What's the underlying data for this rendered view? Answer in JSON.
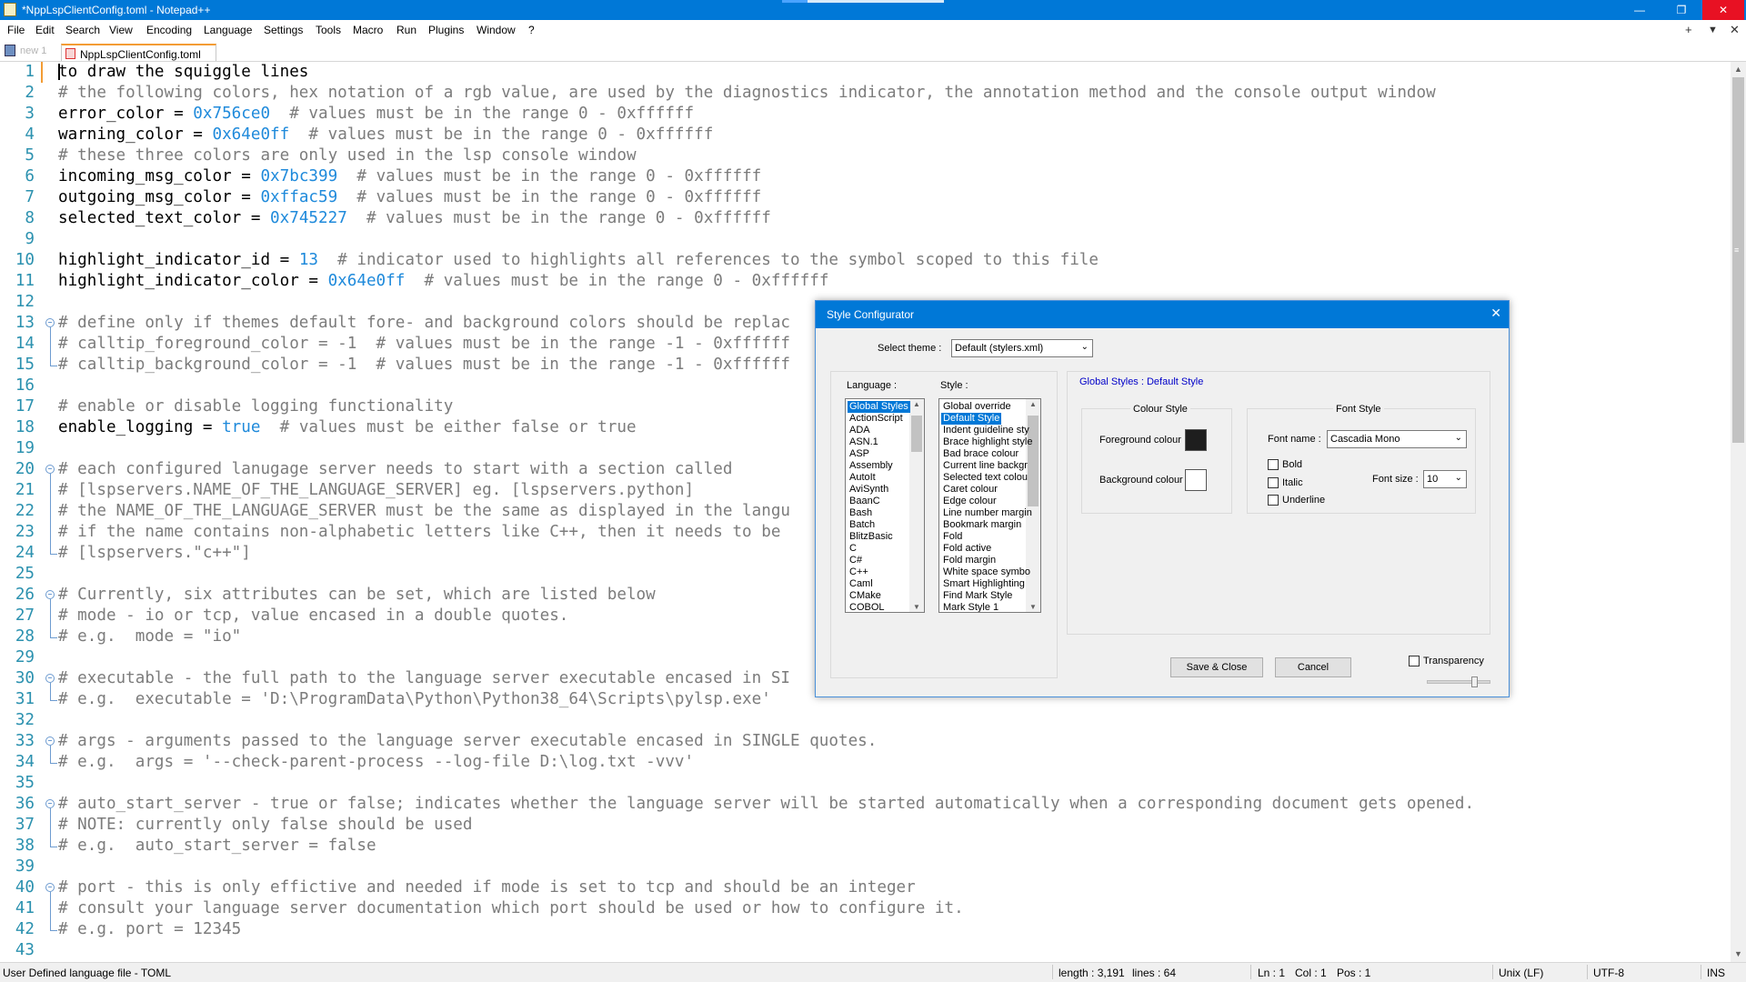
{
  "window": {
    "title": "*NppLspClientConfig.toml - Notepad++",
    "min": "—",
    "restore": "❐",
    "close": "✕"
  },
  "menu": [
    "File",
    "Edit",
    "Search",
    "View",
    "Encoding",
    "Language",
    "Settings",
    "Tools",
    "Macro",
    "Run",
    "Plugins",
    "Window",
    "?"
  ],
  "menu_right": {
    "add": "+",
    "dropdown": "▼",
    "close": "✕"
  },
  "tabs": {
    "ghost": "new 1",
    "active": "NppLspClientConfig.toml"
  },
  "lines": [
    {
      "n": "1",
      "segs": [
        {
          "t": "to draw the squiggle lines",
          "c": ""
        }
      ]
    },
    {
      "n": "2",
      "segs": [
        {
          "t": "# the following colors, hex notation of a rgb value, are used by the diagnostics indicator, the annotation method and the console output window",
          "c": "c-comment"
        }
      ]
    },
    {
      "n": "3",
      "segs": [
        {
          "t": "error_color = ",
          "c": ""
        },
        {
          "t": "0x756ce0",
          "c": "c-num"
        },
        {
          "t": "  # values must be in the range 0 - 0xffffff",
          "c": "c-comment"
        }
      ]
    },
    {
      "n": "4",
      "segs": [
        {
          "t": "warning_color = ",
          "c": ""
        },
        {
          "t": "0x64e0ff",
          "c": "c-num"
        },
        {
          "t": "  # values must be in the range 0 - 0xffffff",
          "c": "c-comment"
        }
      ]
    },
    {
      "n": "5",
      "segs": [
        {
          "t": "# these three colors are only used in the lsp console window",
          "c": "c-comment"
        }
      ]
    },
    {
      "n": "6",
      "segs": [
        {
          "t": "incoming_msg_color = ",
          "c": ""
        },
        {
          "t": "0x7bc399",
          "c": "c-num"
        },
        {
          "t": "  # values must be in the range 0 - 0xffffff",
          "c": "c-comment"
        }
      ]
    },
    {
      "n": "7",
      "segs": [
        {
          "t": "outgoing_msg_color = ",
          "c": ""
        },
        {
          "t": "0xffac59",
          "c": "c-num"
        },
        {
          "t": "  # values must be in the range 0 - 0xffffff",
          "c": "c-comment"
        }
      ]
    },
    {
      "n": "8",
      "segs": [
        {
          "t": "selected_text_color = ",
          "c": ""
        },
        {
          "t": "0x745227",
          "c": "c-num"
        },
        {
          "t": "  # values must be in the range 0 - 0xffffff",
          "c": "c-comment"
        }
      ]
    },
    {
      "n": "9",
      "segs": []
    },
    {
      "n": "10",
      "segs": [
        {
          "t": "highlight_indicator_id = ",
          "c": ""
        },
        {
          "t": "13",
          "c": "c-num"
        },
        {
          "t": "  # indicator used to highlights all references to the symbol scoped to this file",
          "c": "c-comment"
        }
      ]
    },
    {
      "n": "11",
      "segs": [
        {
          "t": "highlight_indicator_color = ",
          "c": ""
        },
        {
          "t": "0x64e0ff",
          "c": "c-num"
        },
        {
          "t": "  # values must be in the range 0 - 0xffffff",
          "c": "c-comment"
        }
      ]
    },
    {
      "n": "12",
      "segs": []
    },
    {
      "n": "13",
      "segs": [
        {
          "t": "# define only if themes default fore- and background colors should be replac",
          "c": "c-comment"
        }
      ]
    },
    {
      "n": "14",
      "segs": [
        {
          "t": "# calltip_foreground_color = -1  # values must be in the range -1 - 0xffffff",
          "c": "c-comment"
        }
      ]
    },
    {
      "n": "15",
      "segs": [
        {
          "t": "# calltip_background_color = -1  # values must be in the range -1 - 0xffffff",
          "c": "c-comment"
        }
      ]
    },
    {
      "n": "16",
      "segs": []
    },
    {
      "n": "17",
      "segs": [
        {
          "t": "# enable or disable logging functionality",
          "c": "c-comment"
        }
      ]
    },
    {
      "n": "18",
      "segs": [
        {
          "t": "enable_logging = ",
          "c": ""
        },
        {
          "t": "true",
          "c": "c-kw"
        },
        {
          "t": "  # values must be either false or true",
          "c": "c-comment"
        }
      ]
    },
    {
      "n": "19",
      "segs": []
    },
    {
      "n": "20",
      "segs": [
        {
          "t": "# each configured lanugage server needs to start with a section called",
          "c": "c-comment"
        }
      ]
    },
    {
      "n": "21",
      "segs": [
        {
          "t": "# [lspservers.NAME_OF_THE_LANGUAGE_SERVER] eg. [lspservers.python]",
          "c": "c-comment"
        }
      ]
    },
    {
      "n": "22",
      "segs": [
        {
          "t": "# the NAME_OF_THE_LANGUAGE_SERVER must be the same as displayed in the langu",
          "c": "c-comment"
        }
      ]
    },
    {
      "n": "23",
      "segs": [
        {
          "t": "# if the name contains non-alphabetic letters like C++, then it needs to be",
          "c": "c-comment"
        }
      ]
    },
    {
      "n": "24",
      "segs": [
        {
          "t": "# [lspservers.\"c++\"]",
          "c": "c-comment"
        }
      ]
    },
    {
      "n": "25",
      "segs": []
    },
    {
      "n": "26",
      "segs": [
        {
          "t": "# Currently, six attributes can be set, which are listed below",
          "c": "c-comment"
        }
      ]
    },
    {
      "n": "27",
      "segs": [
        {
          "t": "# mode - io or tcp, value encased in a double quotes.",
          "c": "c-comment"
        }
      ]
    },
    {
      "n": "28",
      "segs": [
        {
          "t": "# e.g.  mode = \"io\"",
          "c": "c-comment"
        }
      ]
    },
    {
      "n": "29",
      "segs": []
    },
    {
      "n": "30",
      "segs": [
        {
          "t": "# executable - the full path to the language server executable encased in SI",
          "c": "c-comment"
        }
      ]
    },
    {
      "n": "31",
      "segs": [
        {
          "t": "# e.g.  executable = 'D:\\ProgramData\\Python\\Python38_64\\Scripts\\pylsp.exe'",
          "c": "c-comment"
        }
      ]
    },
    {
      "n": "32",
      "segs": []
    },
    {
      "n": "33",
      "segs": [
        {
          "t": "# args - arguments passed to the language server executable encased in SINGLE quotes.",
          "c": "c-comment"
        }
      ]
    },
    {
      "n": "34",
      "segs": [
        {
          "t": "# e.g.  args = '--check-parent-process --log-file D:\\log.txt -vvv'",
          "c": "c-comment"
        }
      ]
    },
    {
      "n": "35",
      "segs": []
    },
    {
      "n": "36",
      "segs": [
        {
          "t": "# auto_start_server - true or false; indicates whether the language server will be started automatically when a corresponding document gets opened.",
          "c": "c-comment"
        }
      ]
    },
    {
      "n": "37",
      "segs": [
        {
          "t": "# NOTE: currently only false should be used",
          "c": "c-comment"
        }
      ]
    },
    {
      "n": "38",
      "segs": [
        {
          "t": "# e.g.  auto_start_server = false",
          "c": "c-comment"
        }
      ]
    },
    {
      "n": "39",
      "segs": []
    },
    {
      "n": "40",
      "segs": [
        {
          "t": "# port - this is only effictive and needed if mode is set to tcp and should be an integer",
          "c": "c-comment"
        }
      ]
    },
    {
      "n": "41",
      "segs": [
        {
          "t": "# consult your language server documentation which port should be used or how to configure it.",
          "c": "c-comment"
        }
      ]
    },
    {
      "n": "42",
      "segs": [
        {
          "t": "# e.g. port = 12345",
          "c": "c-comment"
        }
      ]
    },
    {
      "n": "43",
      "segs": []
    }
  ],
  "status": {
    "filetype": "User Defined language file - TOML",
    "length": "length : 3,191",
    "lines": "lines : 64",
    "ln": "Ln : 1",
    "col": "Col : 1",
    "pos": "Pos : 1",
    "eol": "Unix (LF)",
    "encoding": "UTF-8",
    "mode": "INS"
  },
  "dialog": {
    "title": "Style Configurator",
    "close": "✕",
    "select_theme_label": "Select theme :",
    "theme": "Default (stylers.xml)",
    "language_label": "Language :",
    "style_label": "Style :",
    "languages": [
      "Global Styles",
      "ActionScript",
      "ADA",
      "ASN.1",
      "ASP",
      "Assembly",
      "AutoIt",
      "AviSynth",
      "BaanC",
      "Bash",
      "Batch",
      "BlitzBasic",
      "C",
      "C#",
      "C++",
      "Caml",
      "CMake",
      "COBOL"
    ],
    "styles": [
      "Global override",
      "Default Style",
      "Indent guideline sty",
      "Brace highlight style",
      "Bad brace colour",
      "Current line backgr",
      "Selected text colou",
      "Caret colour",
      "Edge colour",
      "Line number margin",
      "Bookmark margin",
      "Fold",
      "Fold active",
      "Fold margin",
      "White space symbo",
      "Smart Highlighting",
      "Find Mark Style",
      "Mark Style 1"
    ],
    "selected_language": "Global Styles",
    "selected_style": "Default Style",
    "heading": "Global Styles : Default Style",
    "colour_style_label": "Colour Style",
    "foreground_label": "Foreground colour",
    "background_label": "Background colour",
    "foreground_colour": "#1e1e1e",
    "background_colour": "#ffffff",
    "font_style_label": "Font Style",
    "font_name_label": "Font name :",
    "font_name": "Cascadia Mono",
    "font_size_label": "Font size :",
    "font_size": "10",
    "bold_label": "Bold",
    "italic_label": "Italic",
    "underline_label": "Underline",
    "save_label": "Save & Close",
    "cancel_label": "Cancel",
    "transparency_label": "Transparency"
  }
}
